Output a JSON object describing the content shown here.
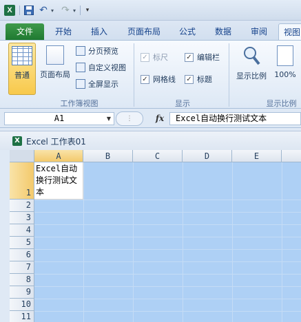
{
  "quick_access": {
    "logo": "X",
    "icons": [
      "excel-logo-icon",
      "save-icon",
      "undo-icon",
      "redo-icon",
      "customize-icon"
    ]
  },
  "tabs": [
    {
      "label": "文件"
    },
    {
      "label": "开始"
    },
    {
      "label": "插入"
    },
    {
      "label": "页面布局"
    },
    {
      "label": "公式"
    },
    {
      "label": "数据"
    },
    {
      "label": "审阅"
    },
    {
      "label": "视图"
    }
  ],
  "ribbon": {
    "workbook_views": {
      "normal": "普通",
      "page_layout": "页面布局",
      "page_break": "分页预览",
      "custom_views": "自定义视图",
      "full_screen": "全屏显示",
      "group_label": "工作簿视图"
    },
    "show": {
      "ruler": "标尺",
      "formula_bar": "编辑栏",
      "gridlines": "网格线",
      "headings": "标题",
      "group_label": "显示"
    },
    "zoom": {
      "zoom": "显示比例",
      "hundred": "100%",
      "group_label": "显示比例"
    }
  },
  "formula_bar": {
    "name_box": "A1",
    "fx": "fx",
    "content": "Excel自动换行测试文本"
  },
  "workbook": {
    "title": "Excel 工作表01"
  },
  "grid": {
    "columns": [
      "A",
      "B",
      "C",
      "D",
      "E"
    ],
    "rows": [
      "1",
      "2",
      "3",
      "4",
      "5",
      "6",
      "7",
      "8",
      "9",
      "10",
      "11"
    ],
    "a1_value": "Excel自动换行测试文本"
  },
  "colors": {
    "selection": "#aed0f5",
    "file_tab": "#2a8a3c",
    "header_active": "#f3c96b"
  }
}
